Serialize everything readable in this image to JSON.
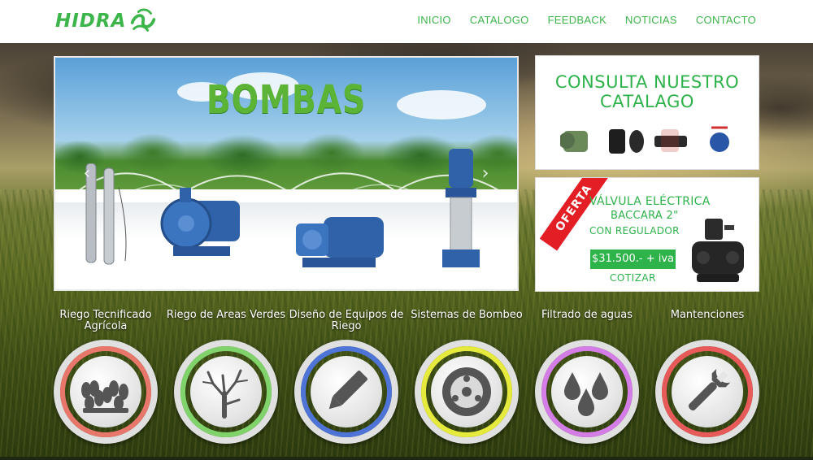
{
  "brand": {
    "name": "HIDRA",
    "color": "#3cb54a"
  },
  "nav": [
    {
      "label": "INICIO"
    },
    {
      "label": "CATALOGO"
    },
    {
      "label": "FEEDBACK"
    },
    {
      "label": "NOTICIAS"
    },
    {
      "label": "CONTACTO"
    }
  ],
  "slider": {
    "title": "BOMBAS",
    "prev_icon": "chevron-left-icon",
    "next_icon": "chevron-right-icon"
  },
  "catalog": {
    "title_line1": "CONSULTA NUESTRO",
    "title_line2": "CATALAGO"
  },
  "offer": {
    "ribbon": "OFERTA",
    "line1": "VÁLVULA ELÉCTRICA",
    "line2": "BACCARA 2\"",
    "line3": "CON REGULADOR",
    "price": "$31.500.- + iva",
    "cta": "COTIZAR",
    "ribbon_color": "#e31e24"
  },
  "services": [
    {
      "label": "Riego Tecnificado Agrícola",
      "icon": "crops-icon",
      "ring_color": "#e8766b"
    },
    {
      "label": "Riego de Areas Verdes",
      "icon": "tree-icon",
      "ring_color": "#7fd36a"
    },
    {
      "label": "Diseño de Equipos de Riego",
      "icon": "pencil-icon",
      "ring_color": "#4f74d8"
    },
    {
      "label": "Sistemas de Bombeo",
      "icon": "pump-disc-icon",
      "ring_color": "#e6ea3c"
    },
    {
      "label": "Filtrado de aguas",
      "icon": "water-drops-icon",
      "ring_color": "#d57de6"
    },
    {
      "label": "Mantenciones",
      "icon": "wrench-icon",
      "ring_color": "#e85a5a"
    }
  ]
}
